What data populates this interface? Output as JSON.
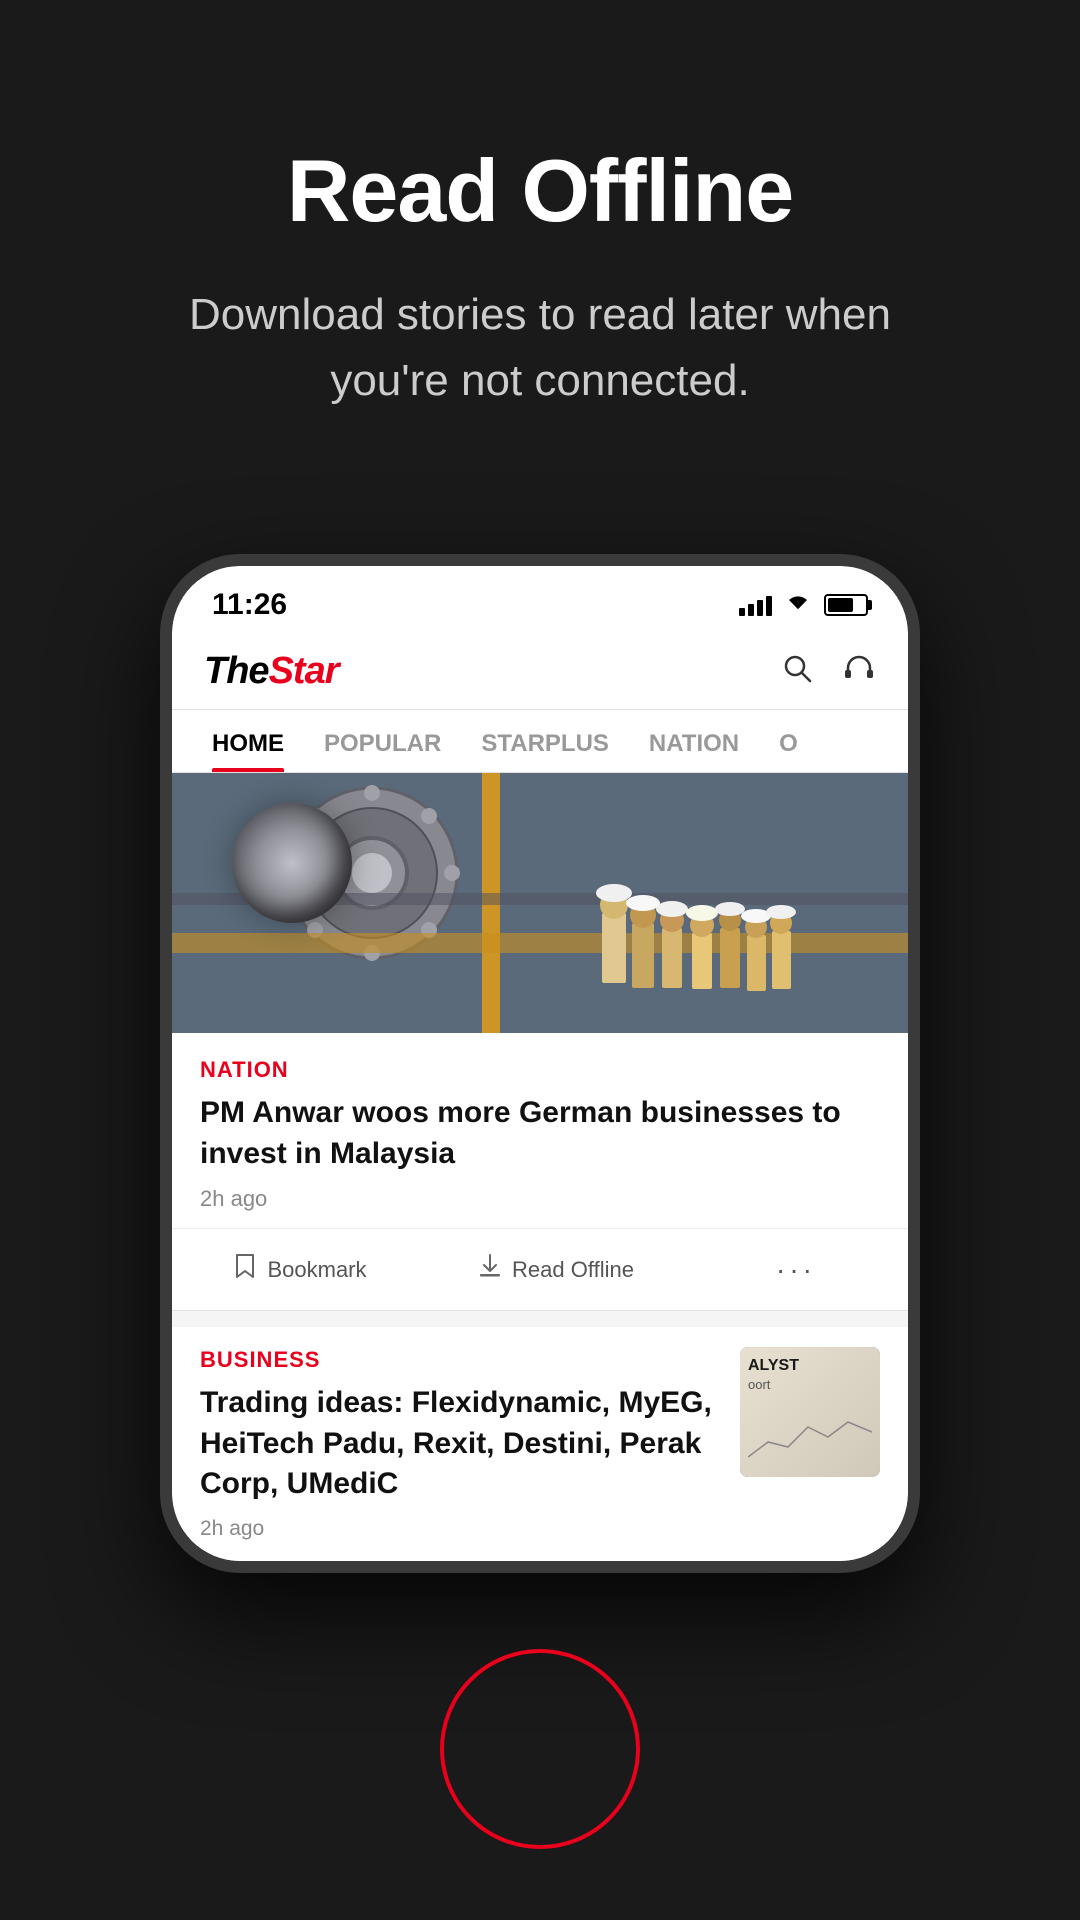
{
  "hero": {
    "title": "Read Offline",
    "subtitle": "Download stories to read later when you're not connected.",
    "bg_color": "#1a1a1a"
  },
  "phone": {
    "status_bar": {
      "time": "11:26"
    },
    "header": {
      "logo_the": "The",
      "logo_star": "Star"
    },
    "nav_tabs": [
      {
        "label": "HOME",
        "active": true
      },
      {
        "label": "POPULAR",
        "active": false
      },
      {
        "label": "STARPLUS",
        "active": false
      },
      {
        "label": "NATION",
        "active": false
      },
      {
        "label": "O",
        "active": false
      }
    ],
    "articles": [
      {
        "category": "NATION",
        "title": "PM Anwar woos more German businesses to invest in Malaysia",
        "time": "2h ago",
        "actions": {
          "bookmark": "Bookmark",
          "read_offline": "Read Offline",
          "more": "···"
        }
      },
      {
        "category": "BUSINESS",
        "title": "Trading ideas: Flexidynamic, MyEG, HeiTech Padu, Rexit, Destini, Perak Corp, UMediC",
        "time": "2h ago",
        "image_label": "ALYST",
        "image_sub": "oort"
      }
    ]
  },
  "colors": {
    "accent_red": "#e8001c",
    "bg_dark": "#1a1a1a",
    "text_white": "#ffffff",
    "text_gray": "#cccccc"
  }
}
